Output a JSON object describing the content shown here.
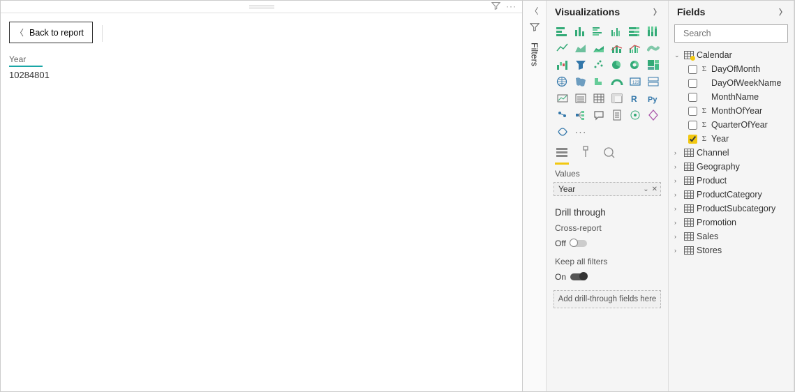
{
  "canvas": {
    "back_button": "Back to report",
    "card_label": "Year",
    "card_value": "10284801"
  },
  "filters": {
    "title": "Filters"
  },
  "viz": {
    "title": "Visualizations",
    "tabs": {
      "values_label": "Values"
    },
    "well_field": "Year",
    "drill": {
      "title": "Drill through",
      "cross_report_label": "Cross-report",
      "cross_report_state": "Off",
      "keep_filters_label": "Keep all filters",
      "keep_filters_state": "On",
      "dropzone": "Add drill-through fields here"
    }
  },
  "fields": {
    "title": "Fields",
    "search_placeholder": "Search",
    "tables": [
      {
        "name": "Calendar",
        "expanded": true,
        "has_selection": true,
        "columns": [
          {
            "name": "DayOfMonth",
            "sigma": true,
            "checked": false
          },
          {
            "name": "DayOfWeekName",
            "sigma": false,
            "checked": false
          },
          {
            "name": "MonthName",
            "sigma": false,
            "checked": false
          },
          {
            "name": "MonthOfYear",
            "sigma": true,
            "checked": false
          },
          {
            "name": "QuarterOfYear",
            "sigma": true,
            "checked": false
          },
          {
            "name": "Year",
            "sigma": true,
            "checked": true
          }
        ]
      },
      {
        "name": "Channel",
        "expanded": false
      },
      {
        "name": "Geography",
        "expanded": false
      },
      {
        "name": "Product",
        "expanded": false
      },
      {
        "name": "ProductCategory",
        "expanded": false
      },
      {
        "name": "ProductSubcategory",
        "expanded": false
      },
      {
        "name": "Promotion",
        "expanded": false
      },
      {
        "name": "Sales",
        "expanded": false
      },
      {
        "name": "Stores",
        "expanded": false
      }
    ]
  },
  "icons": {
    "filter": "filter-icon",
    "more": "more-icon"
  }
}
